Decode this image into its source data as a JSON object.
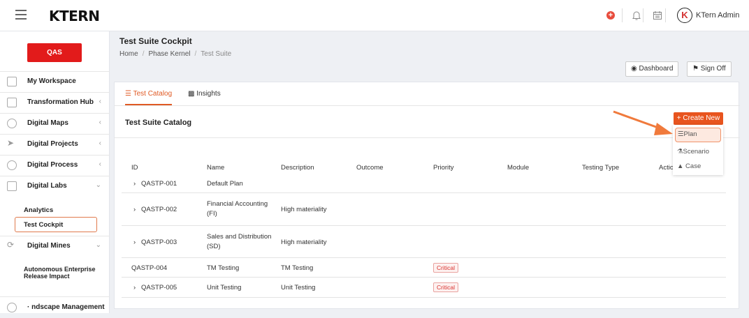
{
  "topbar": {
    "logo": "KTERN",
    "user": "KTern Admin",
    "avatar": "K"
  },
  "sidebar": {
    "env": "QAS",
    "items": [
      {
        "label": "My Workspace"
      },
      {
        "label": "Transformation Hub"
      },
      {
        "label": "Digital Maps"
      },
      {
        "label": "Digital Projects"
      },
      {
        "label": "Digital Process"
      },
      {
        "label": "Digital Labs"
      },
      {
        "label": "Digital Mines"
      },
      {
        "label": "· ndscape Management"
      }
    ],
    "sub_labs": [
      "Analytics",
      "Test Cockpit"
    ],
    "sub_mines": "Autonomous Enterprise Release Impact"
  },
  "page": {
    "title": "Test Suite Cockpit",
    "breadcrumb": [
      "Home",
      "Phase Kernel",
      "Test Suite"
    ],
    "dashboard_btn": "Dashboard",
    "signoff_btn": "Sign Off"
  },
  "tabs": [
    "Test Catalog",
    "Insights"
  ],
  "catalog": {
    "title": "Test Suite Catalog",
    "create_btn": "+ Create New",
    "columns": [
      "ID",
      "Name",
      "Description",
      "Outcome",
      "Priority",
      "Module",
      "Testing Type",
      "Actio"
    ],
    "rows": [
      {
        "id": "QASTP-001",
        "name": "Default Plan",
        "desc": "",
        "priority": ""
      },
      {
        "id": "QASTP-002",
        "name": "Financial Accounting (FI)",
        "desc": "High materiality",
        "priority": ""
      },
      {
        "id": "QASTP-003",
        "name": "Sales and Distribution (SD)",
        "desc": "High materiality",
        "priority": ""
      },
      {
        "id": "QASTP-004",
        "name": "TM Testing",
        "desc": "TM Testing",
        "priority": "Critical"
      },
      {
        "id": "QASTP-005",
        "name": "Unit Testing",
        "desc": "Unit Testing",
        "priority": "Critical"
      }
    ]
  },
  "dropdown": [
    "Plan",
    "Scenario",
    "Case"
  ],
  "colors": {
    "accent": "#e8541e",
    "env": "#e21b1b"
  }
}
